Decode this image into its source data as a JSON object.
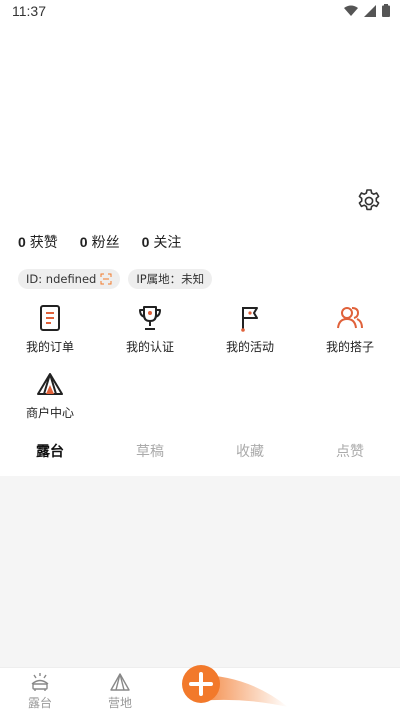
{
  "status_bar": {
    "time": "11:37"
  },
  "profile": {
    "stats": [
      {
        "num": "0",
        "label": "获赞"
      },
      {
        "num": "0",
        "label": "粉丝"
      },
      {
        "num": "0",
        "label": "关注"
      }
    ],
    "tags": {
      "id": "ID: ndefined",
      "ip": "IP属地：未知"
    }
  },
  "features": [
    {
      "label": "我的订单",
      "icon": "order-icon"
    },
    {
      "label": "我的认证",
      "icon": "trophy-icon"
    },
    {
      "label": "我的活动",
      "icon": "flag-icon"
    },
    {
      "label": "我的搭子",
      "icon": "partners-icon"
    },
    {
      "label": "商户中心",
      "icon": "tent-icon"
    }
  ],
  "tabs": [
    "露台",
    "草稿",
    "收藏",
    "点赞"
  ],
  "bottom_nav": {
    "items": [
      "露台",
      "营地"
    ]
  },
  "colors": {
    "accent": "#f2792b",
    "inactive": "#999999"
  }
}
